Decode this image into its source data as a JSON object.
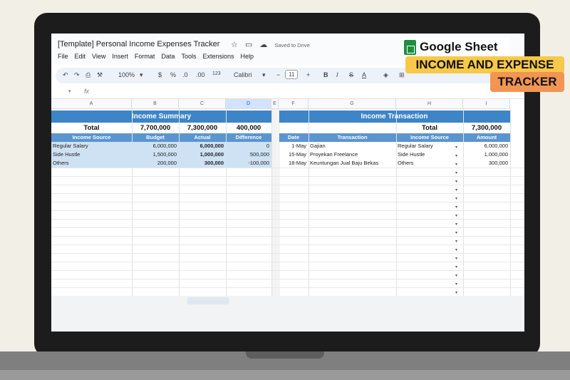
{
  "app": {
    "doc_title": "[Template] Personal Income Expenses Tracker",
    "saved_status": "Saved to Drive",
    "menu": [
      "File",
      "Edit",
      "View",
      "Insert",
      "Format",
      "Data",
      "Tools",
      "Extensions",
      "Help"
    ]
  },
  "toolbar": {
    "zoom": "100%",
    "currency": "$",
    "percent": "%",
    "dec_decrease": ".0",
    "dec_increase": ".00",
    "number_format": "123",
    "font": "Calibri",
    "font_size": "11",
    "minus": "−",
    "plus": "+",
    "bold": "B",
    "italic": "I",
    "strikethrough": "S",
    "text_color": "A"
  },
  "formula_bar": {
    "fx": "fx"
  },
  "columns": [
    "A",
    "B",
    "C",
    "D",
    "E",
    "F",
    "G",
    "H",
    "I"
  ],
  "income_summary": {
    "title": "Income Summary",
    "total_label": "Total",
    "total_budget": "7,700,000",
    "total_actual": "7,300,000",
    "total_difference": "400,000",
    "headers": [
      "Income Source",
      "Budget",
      "Actual",
      "Difference"
    ],
    "rows": [
      {
        "source": "Regular Salary",
        "budget": "6,000,000",
        "actual": "6,000,000",
        "difference": "0"
      },
      {
        "source": "Side Hustle",
        "budget": "1,500,000",
        "actual": "1,000,000",
        "difference": "500,000"
      },
      {
        "source": "Others",
        "budget": "200,000",
        "actual": "300,000",
        "difference": "-100,000"
      }
    ]
  },
  "income_transaction": {
    "title": "Income Transaction",
    "total_label": "Total",
    "total_amount": "7,300,000",
    "headers": [
      "Date",
      "Transaction",
      "Income Source",
      "Amount"
    ],
    "rows": [
      {
        "date": "1-May",
        "transaction": "Gajian",
        "source": "Regular Salary",
        "amount": "6,000,000"
      },
      {
        "date": "15-May",
        "transaction": "Proyekan Freelance",
        "source": "Side Hustle",
        "amount": "1,000,000"
      },
      {
        "date": "18-May",
        "transaction": "Keuntungan Jual Baju Bekas",
        "source": "Others",
        "amount": "300,000"
      }
    ]
  },
  "branding": {
    "logo_text": "Google Sheet",
    "badge_line1": "INCOME AND EXPENSE",
    "badge_line2": "TRACKER",
    "colors": {
      "yellow": "#f8c84a",
      "orange": "#f29553",
      "header_blue": "#3d85c6",
      "row_tint": "#cfe2f3"
    }
  }
}
